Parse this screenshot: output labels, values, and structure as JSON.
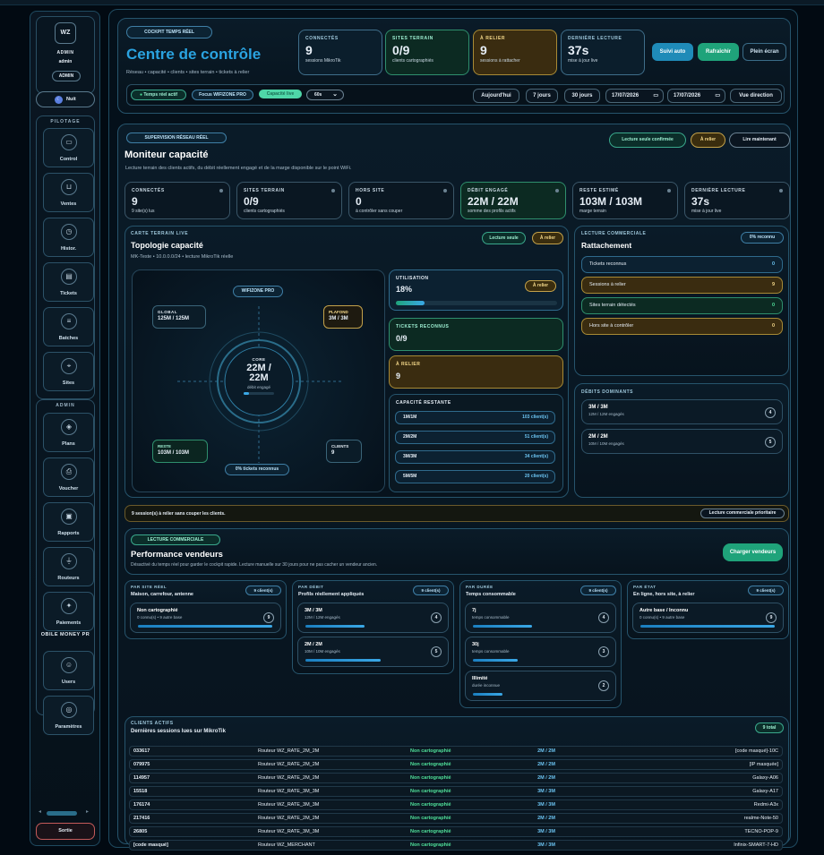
{
  "sidebar": {
    "avatar": "WZ",
    "role": "ADMIN",
    "user": "admin",
    "badge": "ADMIN",
    "theme_toggle": "Nuit",
    "section_pilotage": "PILOTAGE",
    "pilotage_items": [
      {
        "label": "Control",
        "icon": "monitor-icon",
        "glyph": "▭"
      },
      {
        "label": "Ventes",
        "icon": "cart-icon",
        "glyph": "⊔"
      },
      {
        "label": "Histor.",
        "icon": "history-icon",
        "glyph": "◷"
      },
      {
        "label": "Tickets",
        "icon": "ticket-icon",
        "glyph": "▤"
      },
      {
        "label": "Batches",
        "icon": "list-icon",
        "glyph": "≡"
      },
      {
        "label": "Sites",
        "icon": "pin-icon",
        "glyph": "⌖"
      }
    ],
    "section_admin": "ADMIN",
    "admin_items": [
      {
        "label": "Plans",
        "icon": "layers-icon",
        "glyph": "◈"
      },
      {
        "label": "Voucher",
        "icon": "print-icon",
        "glyph": "⎙"
      },
      {
        "label": "Rapports",
        "icon": "report-icon",
        "glyph": "▣"
      },
      {
        "label": "Routeurs",
        "icon": "antenna-icon",
        "glyph": "⏚"
      },
      {
        "label": "Paiements",
        "icon": "payment-icon",
        "glyph": "✦"
      }
    ],
    "section_mobile": "OBILE MONEY PR",
    "mobile_items": [
      {
        "label": "Users",
        "icon": "users-icon",
        "glyph": "☺"
      },
      {
        "label": "Paramètres",
        "icon": "settings-icon",
        "glyph": "◎"
      }
    ],
    "logout": "Sortie"
  },
  "header": {
    "cockpit_pill": "COCKPIT TEMPS RÉEL",
    "title": "Centre de contrôle",
    "subtitle": "Réseau • capacité • clients • sites terrain • tickets à relier",
    "kpis": [
      {
        "title": "CONNECTÉS",
        "value": "9",
        "sub": "sessions MikroTik",
        "tone": "blue"
      },
      {
        "title": "SITES TERRAIN",
        "value": "0/9",
        "sub": "clients cartographiés",
        "tone": "green"
      },
      {
        "title": "À RELIER",
        "value": "9",
        "sub": "sessions à rattacher",
        "tone": "gold"
      },
      {
        "title": "DERNIÈRE LECTURE",
        "value": "37s",
        "sub": "mise à jour live",
        "tone": "blue"
      }
    ],
    "btn_auto": "Suivi auto",
    "btn_refresh": "Rafraîchir",
    "btn_fullscreen": "Plein écran",
    "filters": {
      "realtime": "Temps réel actif",
      "focus": "Focus WIFIZONE PRO",
      "mode": "Capacité live",
      "interval": "60s",
      "today": "Aujourd'hui",
      "days7": "7 jours",
      "days30": "30 jours",
      "date_from": "17/07/2026",
      "date_to": "17/07/2026",
      "direction": "Vue direction"
    }
  },
  "monitor": {
    "pill": "SUPERVISION RÉSEAU RÉEL",
    "title": "Moniteur capacité",
    "subtitle": "Lecture terrain des clients actifs, du débit réellement engagé et de la marge disponible sur le point WiFi.",
    "badge_readonly": "Lecture seule confirmée",
    "badge_link": "À relier",
    "badge_read_now": "Lire maintenant",
    "kpis": [
      {
        "title": "CONNECTÉS",
        "value": "9",
        "sub": "9 site(s) lus",
        "tone": "dark"
      },
      {
        "title": "SITES TERRAIN",
        "value": "0/9",
        "sub": "clients cartographiés",
        "tone": "dark"
      },
      {
        "title": "HORS SITE",
        "value": "0",
        "sub": "à contrôler sans couper",
        "tone": "dark"
      },
      {
        "title": "DÉBIT ENGAGÉ",
        "value": "22M / 22M",
        "sub": "somme des profils actifs",
        "tone": "green"
      },
      {
        "title": "RESTE ESTIMÉ",
        "value": "103M / 103M",
        "sub": "marge terrain",
        "tone": "dark"
      },
      {
        "title": "DERNIÈRE LECTURE",
        "value": "37s",
        "sub": "mise à jour live",
        "tone": "dark"
      }
    ]
  },
  "topology": {
    "pill": "CARTE TERRAIN LIVE",
    "title": "Topologie capacité",
    "subtitle": "MK-Teste • 10.0.0.0/24 • lecture MikroTik réelle",
    "badge_readonly": "Lecture seule",
    "badge_link": "À relier",
    "node_top": "WIFIZONE PRO",
    "global_label": "GLOBAL",
    "global_value": "125M / 125M",
    "ceiling_label": "PLAFOND",
    "ceiling_value": "3M / 3M",
    "core_label": "CORE",
    "core_value": "22M / 22M",
    "core_sub": "débit engagé",
    "core_fill": 0.18,
    "rest_label": "RESTE",
    "rest_value": "103M / 103M",
    "clients_label": "CLIENTS",
    "clients_value": "9",
    "tickets_pill": "0% tickets reconnus"
  },
  "metrics": {
    "utilisation_title": "UTILISATION",
    "utilisation_value": "18%",
    "utilisation_fill": 0.18,
    "utilisation_badge": "À relier",
    "tickets_title": "TICKETS RECONNUS",
    "tickets_value": "0/9",
    "link_title": "À RELIER",
    "link_value": "9",
    "capacity_title": "CAPACITÉ RESTANTE",
    "capacity_rows": [
      {
        "plan": "1M/1M",
        "clients": "103 client(s)"
      },
      {
        "plan": "2M/2M",
        "clients": "51 client(s)"
      },
      {
        "plan": "3M/3M",
        "clients": "34 client(s)"
      },
      {
        "plan": "5M/5M",
        "clients": "20 client(s)"
      }
    ]
  },
  "attachment": {
    "pill": "LECTURE COMMERCIALE",
    "title": "Rattachement",
    "badge": "0% reconnu",
    "rows": [
      {
        "label": "Tickets reconnus",
        "count": "0",
        "tone": "blue"
      },
      {
        "label": "Sessions à relier",
        "count": "9",
        "tone": "gold"
      },
      {
        "label": "Sites terrain détectés",
        "count": "0",
        "tone": "green"
      },
      {
        "label": "Hors site à contrôler",
        "count": "0",
        "tone": "gold"
      }
    ]
  },
  "dominant": {
    "title": "DÉBITS DOMINANTS",
    "items": [
      {
        "rate": "3M / 3M",
        "sub": "12M / 12M engagés",
        "count": "4"
      },
      {
        "rate": "2M / 2M",
        "sub": "10M / 10M engagés",
        "count": "5"
      }
    ]
  },
  "alert": {
    "text": "9 session(s) à relier sans couper les clients.",
    "badge": "Lecture commerciale prioritaire"
  },
  "vendors": {
    "pill": "LECTURE COMMERCIALE",
    "title": "Performance vendeurs",
    "subtitle": "Désactivé du temps réel pour garder le cockpit rapide. Lecture manuelle sur 30 jours pour ne pas cacher un vendeur ancien.",
    "button": "Charger vendeurs"
  },
  "breakdown": [
    {
      "pill": "PAR SITE RÉEL",
      "title": "Maison, carrefour, antenne",
      "badge": "9 client(s)",
      "items": [
        {
          "a": "Non cartographié",
          "b": "0 connu(s) • 9 autre base",
          "count": "9",
          "fill": 1.0
        }
      ]
    },
    {
      "pill": "PAR DÉBIT",
      "title": "Profils réellement appliqués",
      "badge": "9 client(s)",
      "items": [
        {
          "a": "3M / 3M",
          "b": "12M / 12M engagés",
          "count": "4",
          "fill": 0.44
        },
        {
          "a": "2M / 2M",
          "b": "10M / 10M engagés",
          "count": "5",
          "fill": 0.56
        }
      ]
    },
    {
      "pill": "PAR DURÉE",
      "title": "Temps consommable",
      "badge": "9 client(s)",
      "items": [
        {
          "a": "7j",
          "b": "temps consommable",
          "count": "4",
          "fill": 0.44
        },
        {
          "a": "30j",
          "b": "temps consommable",
          "count": "3",
          "fill": 0.33
        },
        {
          "a": "Illimité",
          "b": "durée inconnue",
          "count": "2",
          "fill": 0.22
        }
      ]
    },
    {
      "pill": "PAR ÉTAT",
      "title": "En ligne, hors site, à relier",
      "badge": "9 client(s)",
      "items": [
        {
          "a": "Autre base / Inconnu",
          "b": "0 connu(s) • 9 autre base",
          "count": "9",
          "fill": 1.0
        }
      ]
    }
  ],
  "clients": {
    "pill": "CLIENTS ACTIFS",
    "title": "Dernières sessions lues sur MikroTik",
    "badge": "9 total",
    "rows": [
      [
        "033617",
        "Routeur WZ_RATE_2M_2M",
        "Non cartographié",
        "2M / 2M",
        "[code masqué]-10C"
      ],
      [
        "079975",
        "Routeur WZ_RATE_2M_2M",
        "Non cartographié",
        "2M / 2M",
        "[IP masquée]"
      ],
      [
        "114957",
        "Routeur WZ_RATE_2M_2M",
        "Non cartographié",
        "2M / 2M",
        "Galaxy-A06"
      ],
      [
        "15518",
        "Routeur WZ_RATE_3M_3M",
        "Non cartographié",
        "3M / 3M",
        "Galaxy-A17"
      ],
      [
        "176174",
        "Routeur WZ_RATE_3M_3M",
        "Non cartographié",
        "3M / 3M",
        "Redmi-A3x"
      ],
      [
        "217416",
        "Routeur WZ_RATE_2M_2M",
        "Non cartographié",
        "2M / 2M",
        "realme-Note-50"
      ],
      [
        "26805",
        "Routeur WZ_RATE_3M_3M",
        "Non cartographié",
        "3M / 3M",
        "TECNO-POP-9"
      ],
      [
        "[code masqué]",
        "Routeur WZ_MERCHANT",
        "Non cartographié",
        "3M / 3M",
        "Infinix-SMART-7-HD"
      ]
    ]
  },
  "colors": {
    "accent": "#1fa37a",
    "blue": "#1f8bb8",
    "gold": "#c4a24a",
    "bg": "#020a12"
  }
}
